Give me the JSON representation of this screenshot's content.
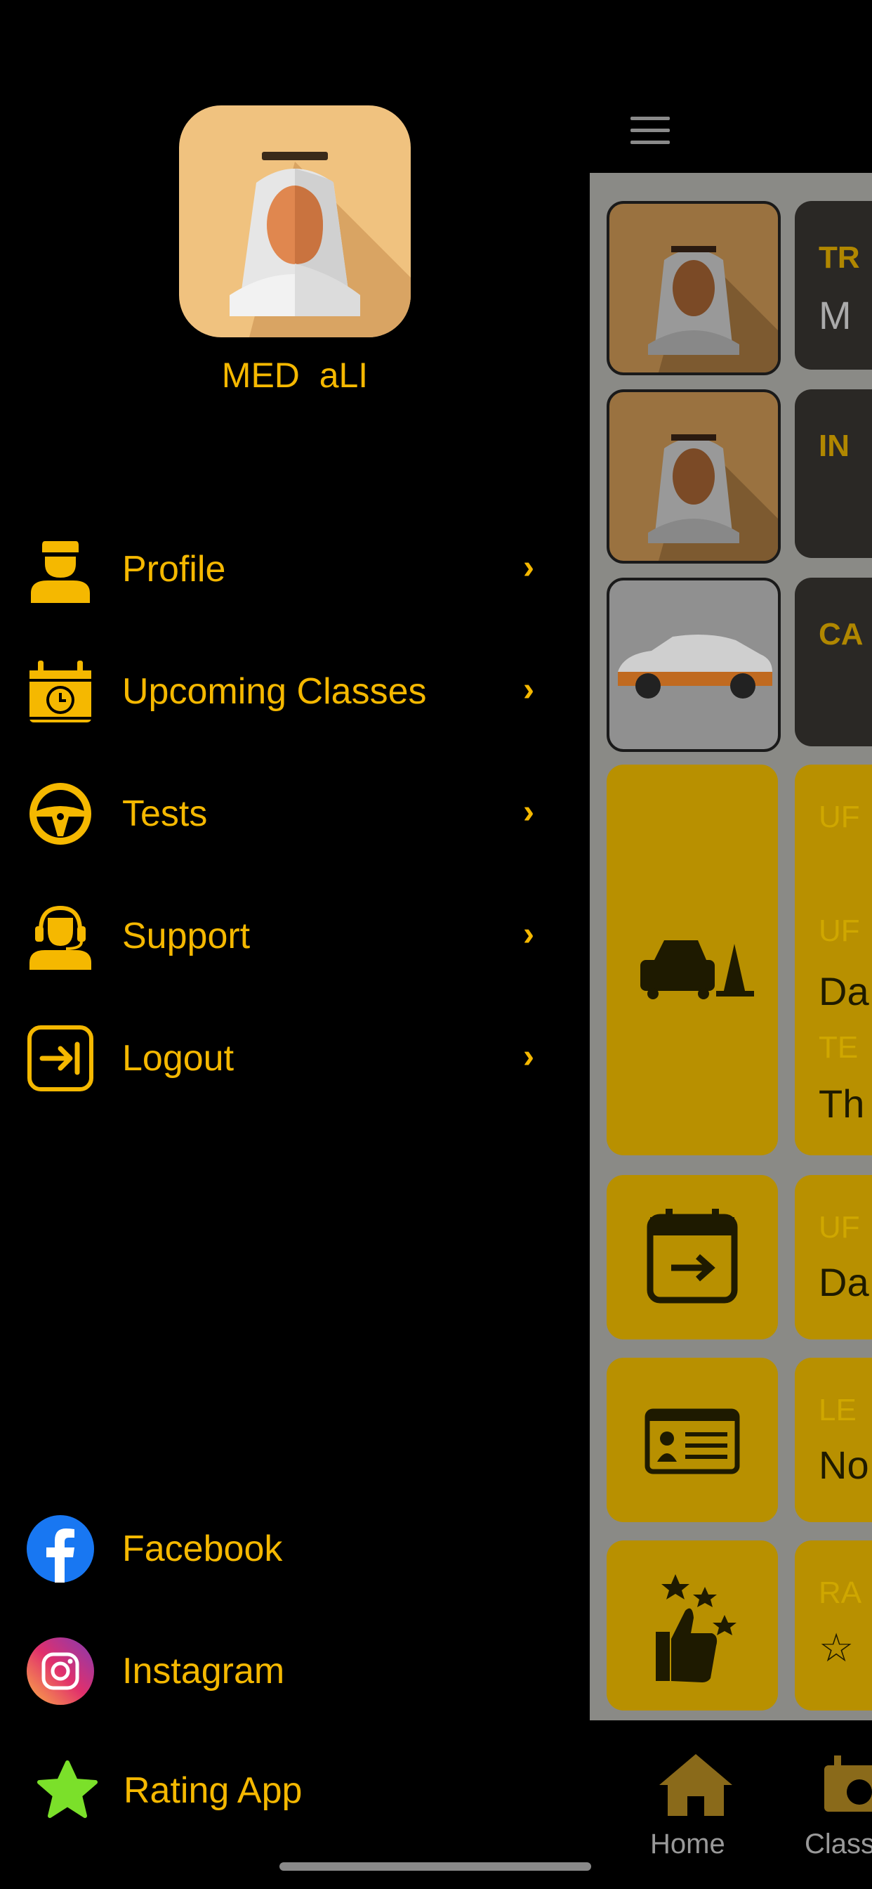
{
  "user": {
    "name": "MED  aLI"
  },
  "menu": {
    "items": [
      {
        "label": "Profile",
        "icon": "user-icon"
      },
      {
        "label": "Upcoming Classes",
        "icon": "calendar-clock-icon"
      },
      {
        "label": "Tests",
        "icon": "steering-wheel-icon"
      },
      {
        "label": "Support",
        "icon": "headset-agent-icon"
      },
      {
        "label": "Logout",
        "icon": "logout-icon"
      }
    ]
  },
  "social": {
    "items": [
      {
        "label": "Facebook",
        "icon": "facebook-icon"
      },
      {
        "label": "Instagram",
        "icon": "instagram-icon"
      },
      {
        "label": "Rating App",
        "icon": "star-icon"
      }
    ]
  },
  "main": {
    "cards": [
      {
        "label": "TR",
        "value": "M"
      },
      {
        "label": "IN",
        "value": ""
      },
      {
        "label": "CA",
        "value": ""
      },
      {
        "label": "UF",
        "label2": "UF",
        "value": "Da",
        "label3": "TE",
        "value2": "Th"
      },
      {
        "label": "UF",
        "value": "Da"
      },
      {
        "label": "LE",
        "value": "No"
      },
      {
        "label": "RA",
        "value": "☆"
      }
    ]
  },
  "tabbar": {
    "home": "Home",
    "classes": "Class"
  },
  "colors": {
    "accent": "#f5b800",
    "background": "#000000",
    "rating_star": "#7be02a"
  }
}
